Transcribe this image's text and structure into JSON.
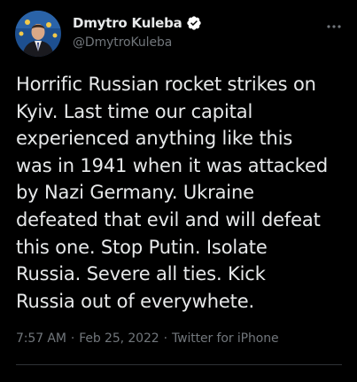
{
  "author": {
    "name": "Dmytro Kuleba",
    "handle": "@DmytroKuleba",
    "verified": true
  },
  "tweet": {
    "text": "Horrific Russian rocket strikes on\nKyiv. Last time our capital\nexperienced anything like this\nwas in 1941 when it was attacked\nby Nazi Germany. Ukraine\ndefeated that evil and will defeat\nthis one. Stop Putin. Isolate\nRussia. Severe all ties. Kick\nRussia out of everywhete.",
    "time": "7:57 AM",
    "separator": "·",
    "date": "Feb 25, 2022",
    "source": "Twitter for iPhone"
  },
  "icons": {
    "verified": "verified-badge-icon",
    "more": "more-options-icon"
  },
  "colors": {
    "background": "#000000",
    "text_primary": "#e7e9ea",
    "text_secondary": "#71767b",
    "divider": "#2f3336"
  }
}
